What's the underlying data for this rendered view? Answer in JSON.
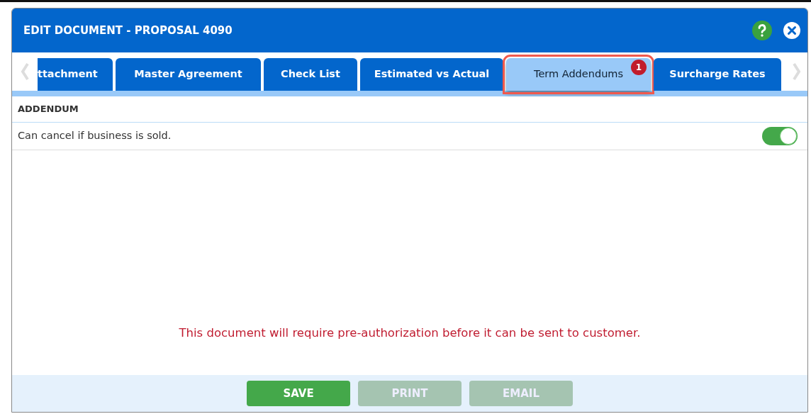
{
  "window": {
    "title": "EDIT DOCUMENT - PROPOSAL 4090"
  },
  "tabs": [
    {
      "label": "ttachment",
      "selected": false
    },
    {
      "label": "Master Agreement",
      "selected": false
    },
    {
      "label": "Check List",
      "selected": false
    },
    {
      "label": "Estimated vs Actual",
      "selected": false
    },
    {
      "label": "Term Addendums",
      "selected": true,
      "badge": "1",
      "highlighted": true
    },
    {
      "label": "Surcharge Rates",
      "selected": false
    }
  ],
  "section": {
    "heading": "ADDENDUM",
    "rows": [
      {
        "label": "Can cancel if business is sold.",
        "on": true
      }
    ]
  },
  "notice": "This document will require pre-authorization before it can be sent to customer.",
  "buttons": [
    {
      "label": "SAVE",
      "disabled": false
    },
    {
      "label": "PRINT",
      "disabled": true
    },
    {
      "label": "EMAIL",
      "disabled": true
    }
  ]
}
